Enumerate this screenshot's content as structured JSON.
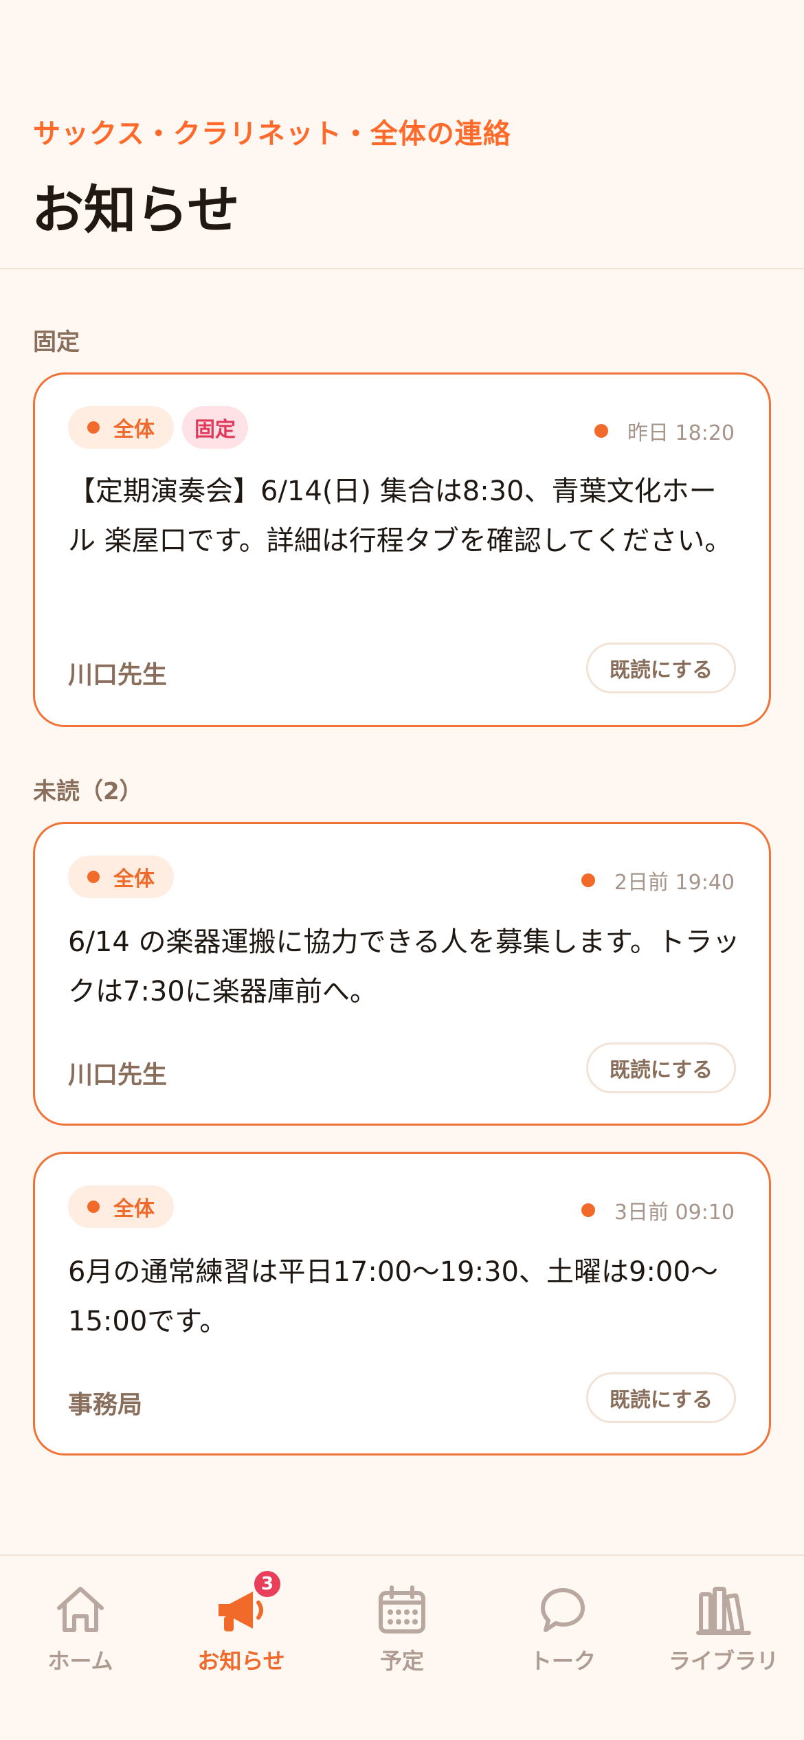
{
  "header": {
    "subtitle": "サックス・クラリネット・全体の連絡",
    "title": "お知らせ"
  },
  "sections": {
    "pinned_label": "固定",
    "unread_label": "未読（2）"
  },
  "cards": [
    {
      "chip_all": "全体",
      "chip_pin": "固定",
      "time": "昨日 18:20",
      "body": "【定期演奏会】6/14(日) 集合は8:30、青葉文化ホール 楽屋口です。詳細は行程タブを確認してください。",
      "author": "川口先生",
      "read_label": "既読にする"
    },
    {
      "chip_all": "全体",
      "time": "2日前 19:40",
      "body": "6/14 の楽器運搬に協力できる人を募集します。トラックは7:30に楽器庫前へ。",
      "author": "川口先生",
      "read_label": "既読にする"
    },
    {
      "chip_all": "全体",
      "time": "3日前 09:10",
      "body": "6月の通常練習は平日17:00〜19:30、土曜は9:00〜15:00です。",
      "author": "事務局",
      "read_label": "既読にする"
    }
  ],
  "tabbar": {
    "items": [
      {
        "label": "ホーム",
        "icon": "home-icon"
      },
      {
        "label": "お知らせ",
        "icon": "megaphone-icon",
        "badge": "3",
        "active": true
      },
      {
        "label": "予定",
        "icon": "calendar-icon"
      },
      {
        "label": "トーク",
        "icon": "chat-bubble-icon"
      },
      {
        "label": "ライブラリ",
        "icon": "library-icon"
      }
    ]
  },
  "colors": {
    "accent": "#F06A2C",
    "background": "#FFF7F1",
    "badge": "#E83F5B",
    "pin_chip_text": "#E0395C"
  }
}
